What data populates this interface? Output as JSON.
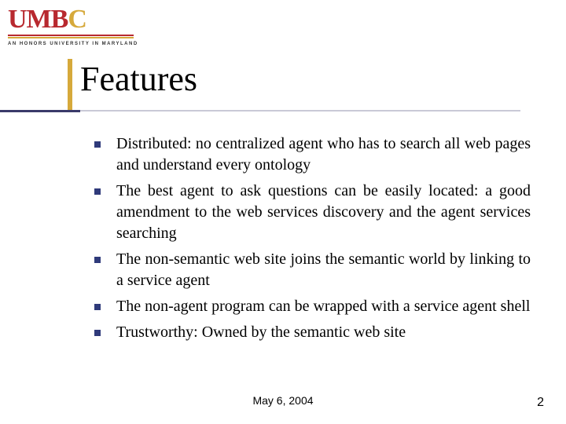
{
  "logo": {
    "text_pre": "UMB",
    "text_last": "C",
    "tagline": "AN HONORS UNIVERSITY IN MARYLAND"
  },
  "title": "Features",
  "bullets": [
    "Distributed: no centralized agent who has to search all web pages and understand every ontology",
    "The best agent to ask questions can be easily located: a good amendment to the web services discovery and the agent services searching",
    "The non-semantic web site joins the semantic world by linking to a service agent",
    "The non-agent program can be wrapped with a service agent shell",
    "Trustworthy: Owned by the semantic web site"
  ],
  "footer": {
    "date": "May 6, 2004",
    "page_number": "2"
  }
}
